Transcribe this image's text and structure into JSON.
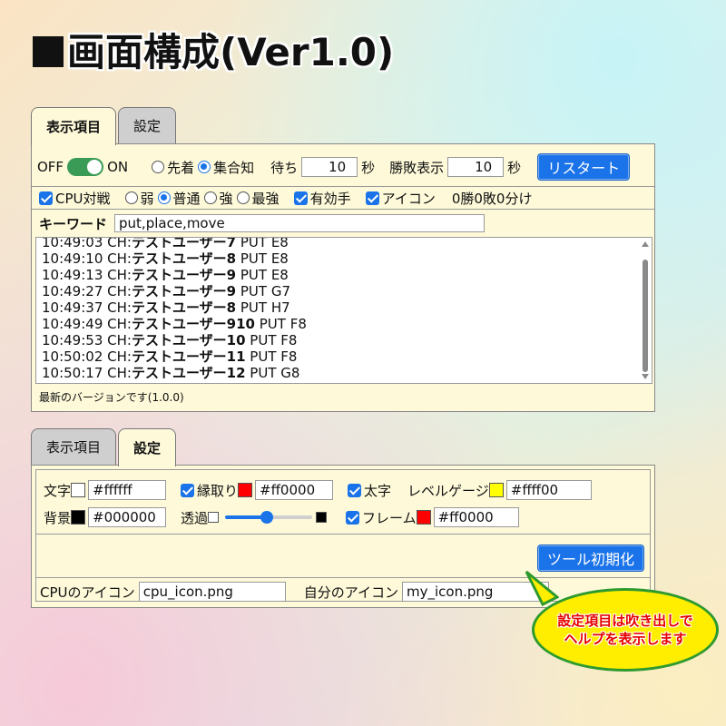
{
  "page_title": "画面構成(Ver1.0)",
  "panel1": {
    "tabs": [
      {
        "label": "表示項目",
        "active": true
      },
      {
        "label": "設定",
        "active": false
      }
    ],
    "row1": {
      "off_label": "OFF",
      "on_label": "ON",
      "toggle_on": true,
      "radio_first": "先着",
      "radio_group": "集合知",
      "wait_label": "待ち",
      "wait_value": "10",
      "wait_unit": "秒",
      "winloss_label": "勝敗表示",
      "winloss_value": "10",
      "winloss_unit": "秒",
      "restart_button": "リスタート"
    },
    "row2": {
      "cpu_battle": "CPU対戦",
      "level_weak": "弱",
      "level_normal": "普通",
      "level_strong": "強",
      "level_strongest": "最強",
      "valid_moves": "有効手",
      "icon": "アイコン",
      "record": "0勝0敗0分け"
    },
    "keyword": {
      "label": "キーワード",
      "value": "put,place,move"
    },
    "log": [
      {
        "time": "10:49:03",
        "prefix": "CH:",
        "user": "テストユーザー7",
        "move": "PUT E8"
      },
      {
        "time": "10:49:10",
        "prefix": "CH:",
        "user": "テストユーザー8",
        "move": "PUT E8"
      },
      {
        "time": "10:49:13",
        "prefix": "CH:",
        "user": "テストユーザー9",
        "move": "PUT E8"
      },
      {
        "time": "10:49:27",
        "prefix": "CH:",
        "user": "テストユーザー9",
        "move": "PUT G7"
      },
      {
        "time": "10:49:37",
        "prefix": "CH:",
        "user": "テストユーザー8",
        "move": "PUT H7"
      },
      {
        "time": "10:49:49",
        "prefix": "CH:",
        "user": "テストユーザー910",
        "move": "PUT F8"
      },
      {
        "time": "10:49:53",
        "prefix": "CH:",
        "user": "テストユーザー10",
        "move": "PUT F8"
      },
      {
        "time": "10:50:02",
        "prefix": "CH:",
        "user": "テストユーザー11",
        "move": "PUT F8"
      },
      {
        "time": "10:50:17",
        "prefix": "CH:",
        "user": "テストユーザー12",
        "move": "PUT G8"
      }
    ],
    "status": "最新のバージョンです(1.0.0)"
  },
  "panel2": {
    "tabs": [
      {
        "label": "表示項目",
        "active": false
      },
      {
        "label": "設定",
        "active": true
      }
    ],
    "text_label": "文字",
    "text_color": "#ffffff",
    "outline_label": "縁取り",
    "outline_color": "#ff0000",
    "bold_label": "太字",
    "gauge_label": "レベルゲージ",
    "gauge_color": "#ffff00",
    "bg_label": "背景",
    "bg_color": "#000000",
    "opacity_label": "透過",
    "opacity_level": 0.48,
    "frame_label": "フレーム",
    "frame_color": "#ff0000",
    "reset_button": "ツール初期化",
    "cpu_icon_label": "CPUのアイコン",
    "cpu_icon_value": "cpu_icon.png",
    "my_icon_label": "自分のアイコン",
    "my_icon_value": "my_icon.png"
  },
  "bubble": {
    "line1": "設定項目は吹き出しで",
    "line2": "ヘルプを表示します"
  }
}
